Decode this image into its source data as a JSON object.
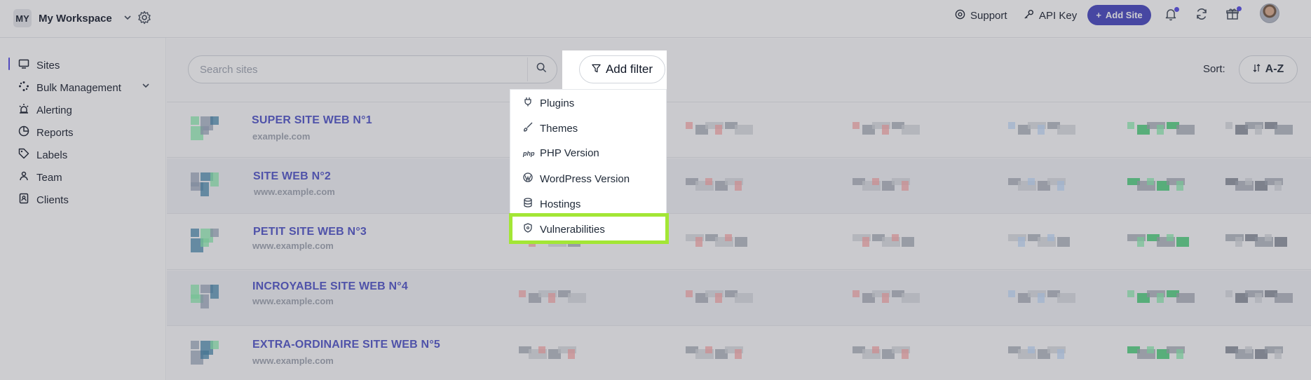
{
  "workspace": {
    "initials": "MY",
    "name": "My Workspace"
  },
  "topbar": {
    "support_label": "Support",
    "api_key_label": "API Key",
    "add_site_label": "Add Site"
  },
  "sidebar": {
    "items": [
      {
        "label": "Sites",
        "icon": "monitor-icon"
      },
      {
        "label": "Bulk Management",
        "icon": "grid-dots-icon"
      },
      {
        "label": "Alerting",
        "icon": "alert-icon"
      },
      {
        "label": "Reports",
        "icon": "chart-icon"
      },
      {
        "label": "Labels",
        "icon": "tag-icon"
      },
      {
        "label": "Team",
        "icon": "team-icon"
      },
      {
        "label": "Clients",
        "icon": "contacts-icon"
      }
    ]
  },
  "main": {
    "search_placeholder": "Search sites",
    "filter_label": "Add filter",
    "sort_label": "Sort:",
    "sort_value": "A-Z",
    "sites": [
      {
        "title": "SUPER SITE WEB N°1",
        "url": "example.com"
      },
      {
        "title": "SITE WEB N°2",
        "url": "www.example.com"
      },
      {
        "title": "PETIT SITE WEB N°3",
        "url": "www.example.com"
      },
      {
        "title": "INCROYABLE SITE WEB N°4",
        "url": "www.example.com"
      },
      {
        "title": "EXTRA-ORDINAIRE SITE WEB N°5",
        "url": "www.example.com"
      }
    ]
  },
  "filter_menu": {
    "items": [
      {
        "label": "Plugins",
        "icon": "plug-icon"
      },
      {
        "label": "Themes",
        "icon": "brush-icon"
      },
      {
        "label": "PHP Version",
        "icon": "php-icon"
      },
      {
        "label": "WordPress Version",
        "icon": "wordpress-icon"
      },
      {
        "label": "Hostings",
        "icon": "database-icon"
      },
      {
        "label": "Vulnerabilities",
        "icon": "shield-icon"
      }
    ],
    "highlighted": "Vulnerabilities"
  },
  "colors": {
    "accent": "#4f46e5",
    "add_site_bg": "#3f3fbe",
    "highlight": "#a3e635",
    "site_title": "#4b50c8"
  }
}
